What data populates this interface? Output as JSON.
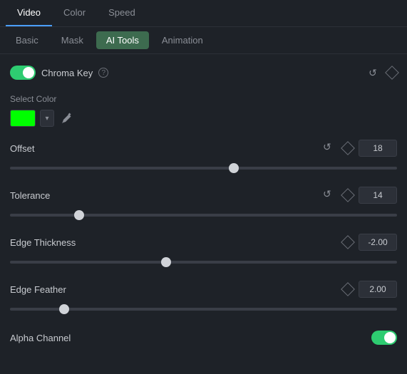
{
  "topTabs": {
    "items": [
      {
        "label": "Video",
        "active": true
      },
      {
        "label": "Color",
        "active": false
      },
      {
        "label": "Speed",
        "active": false
      }
    ]
  },
  "subTabs": {
    "items": [
      {
        "label": "Basic",
        "active": false
      },
      {
        "label": "Mask",
        "active": false
      },
      {
        "label": "AI Tools",
        "active": true
      },
      {
        "label": "Animation",
        "active": false
      }
    ]
  },
  "chromaKey": {
    "label": "Chroma Key",
    "help": "?",
    "enabled": true
  },
  "selectColor": {
    "label": "Select Color",
    "color": "#00ff00"
  },
  "offset": {
    "label": "Offset",
    "value": "18",
    "min": 0,
    "max": 100,
    "current": 58
  },
  "tolerance": {
    "label": "Tolerance",
    "value": "14",
    "min": 0,
    "max": 100,
    "current": 17
  },
  "edgeThickness": {
    "label": "Edge Thickness",
    "value": "-2.00",
    "min": -10,
    "max": 10,
    "current": 40
  },
  "edgeFeather": {
    "label": "Edge Feather",
    "value": "2.00",
    "min": 0,
    "max": 10,
    "current": 13
  },
  "alphaChannel": {
    "label": "Alpha Channel",
    "enabled": true
  }
}
